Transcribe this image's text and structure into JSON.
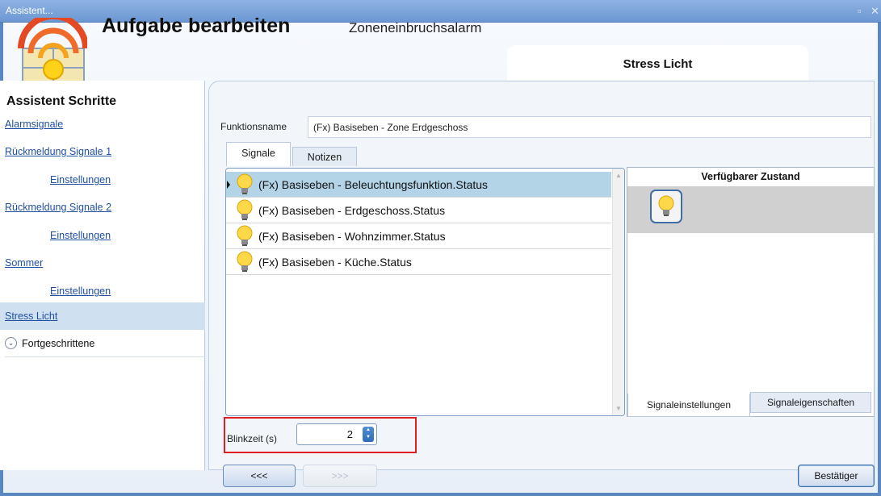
{
  "window": {
    "title": "Assistent...",
    "controls": [
      "restore",
      "close"
    ]
  },
  "header": {
    "title": "Aufgabe bearbeiten",
    "subtitle": "Zoneneinbruchsalarm",
    "section_tab": "Stress Licht"
  },
  "sidebar": {
    "heading": "Assistent Schritte",
    "items": [
      {
        "label": "Alarmsignale",
        "level": 0
      },
      {
        "label": "Rückmeldung Signale 1",
        "level": 0
      },
      {
        "label": "Einstellungen",
        "level": 1
      },
      {
        "label": "Rückmeldung Signale 2",
        "level": 0
      },
      {
        "label": "Einstellungen",
        "level": 1
      },
      {
        "label": "Sommer",
        "level": 0
      },
      {
        "label": "Einstellungen",
        "level": 1
      },
      {
        "label": "Stress Licht",
        "level": 0,
        "active": true
      }
    ],
    "advanced": {
      "label": "Fortgeschrittene",
      "icon": "chevron-down-icon"
    }
  },
  "form": {
    "function_name_label": "Funktionsname",
    "function_name_value": "(Fx) Basiseben - Zone Erdgeschoss",
    "tabs": {
      "signals": "Signale",
      "notes": "Notizen"
    },
    "signals": [
      {
        "label": "(Fx) Basiseben - Beleuchtungsfunktion.Status",
        "icon": "lightbulb-icon",
        "selected": true
      },
      {
        "label": "(Fx) Basiseben - Erdgeschoss.Status",
        "icon": "lightbulb-icon"
      },
      {
        "label": "(Fx) Basiseben - Wohnzimmer.Status",
        "icon": "lightbulb-icon"
      },
      {
        "label": "(Fx) Basiseben - Küche.Status",
        "icon": "lightbulb-icon"
      }
    ],
    "state_panel": {
      "heading": "Verfügbarer Zustand",
      "state_icon": "lightbulb-icon"
    },
    "bottom_tabs": {
      "settings": "Signaleinstellungen",
      "properties": "Signaleigenschaften"
    },
    "blink": {
      "label": "Blinkzeit (s)",
      "value": "2"
    }
  },
  "footer": {
    "back": "<<<",
    "next": ">>>",
    "confirm": "Bestätiger"
  },
  "colors": {
    "titlebar": "#7ba3da",
    "selected_row": "#b2d4e6",
    "highlight_border": "#e02020",
    "link": "#1f4fa3"
  }
}
